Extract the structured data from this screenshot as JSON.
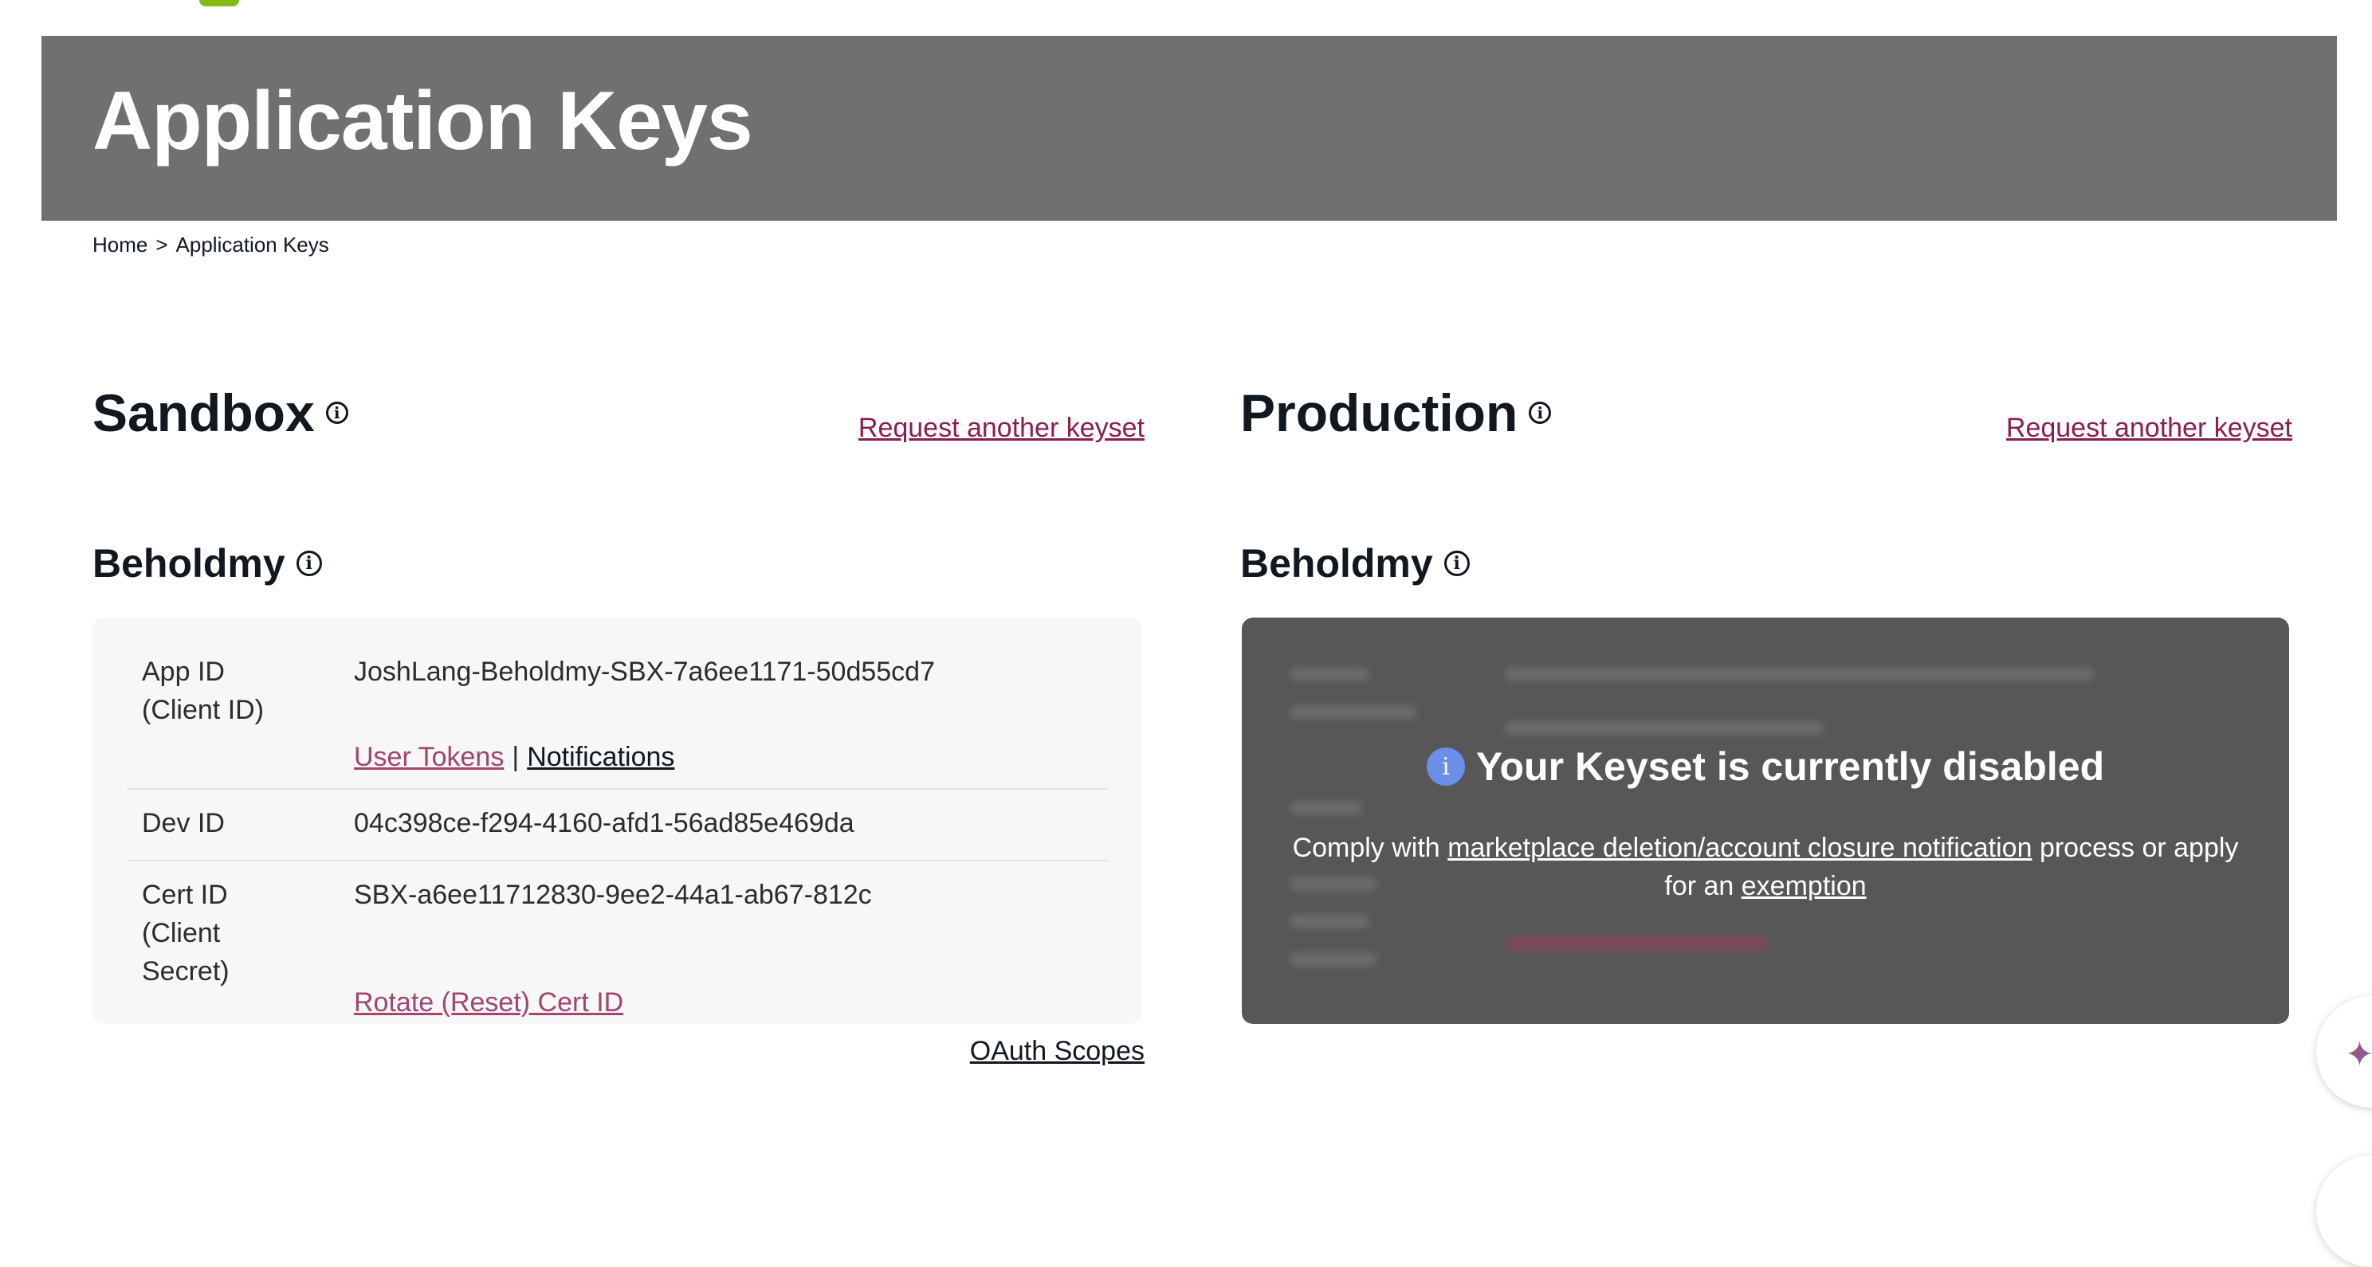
{
  "page": {
    "title": "Application Keys"
  },
  "breadcrumb": {
    "home": "Home",
    "separator": ">",
    "current": "Application Keys"
  },
  "sandbox": {
    "title": "Sandbox",
    "request_link": "Request another keyset",
    "app_name": "Beholdmy",
    "rows": [
      {
        "label": "App ID\n(Client ID)",
        "value": "JoshLang-Beholdmy-SBX-7a6ee1171-50d55cd7"
      },
      {
        "label": "Dev ID",
        "value": "04c398ce-f294-4160-afd1-56ad85e469da"
      },
      {
        "label": "Cert ID\n(Client\nSecret)",
        "value": "SBX-a6ee11712830-9ee2-44a1-ab67-812c"
      }
    ],
    "user_tokens_link": "User Tokens",
    "pipe": "|",
    "notifications_link": "Notifications",
    "rotate_link": "Rotate (Reset) Cert ID",
    "oauth_link": "OAuth Scopes"
  },
  "production": {
    "title": "Production",
    "request_link": "Request another keyset",
    "app_name": "Beholdmy",
    "disabled_title": "Your Keyset is currently disabled",
    "disabled_msg_pre": "Comply with",
    "disabled_link1": "marketplace deletion/account closure notification",
    "disabled_msg_mid": "process or apply for an",
    "disabled_link2": "exemption"
  },
  "icons": {
    "info": "info-icon",
    "sparkle": "sparkle-icon"
  },
  "colors": {
    "banner": "#707070",
    "link_pink": "#a2456f",
    "request_link": "#8a1e4e",
    "disabled_bg": "#575757",
    "info_blue": "#6b8fe8"
  }
}
